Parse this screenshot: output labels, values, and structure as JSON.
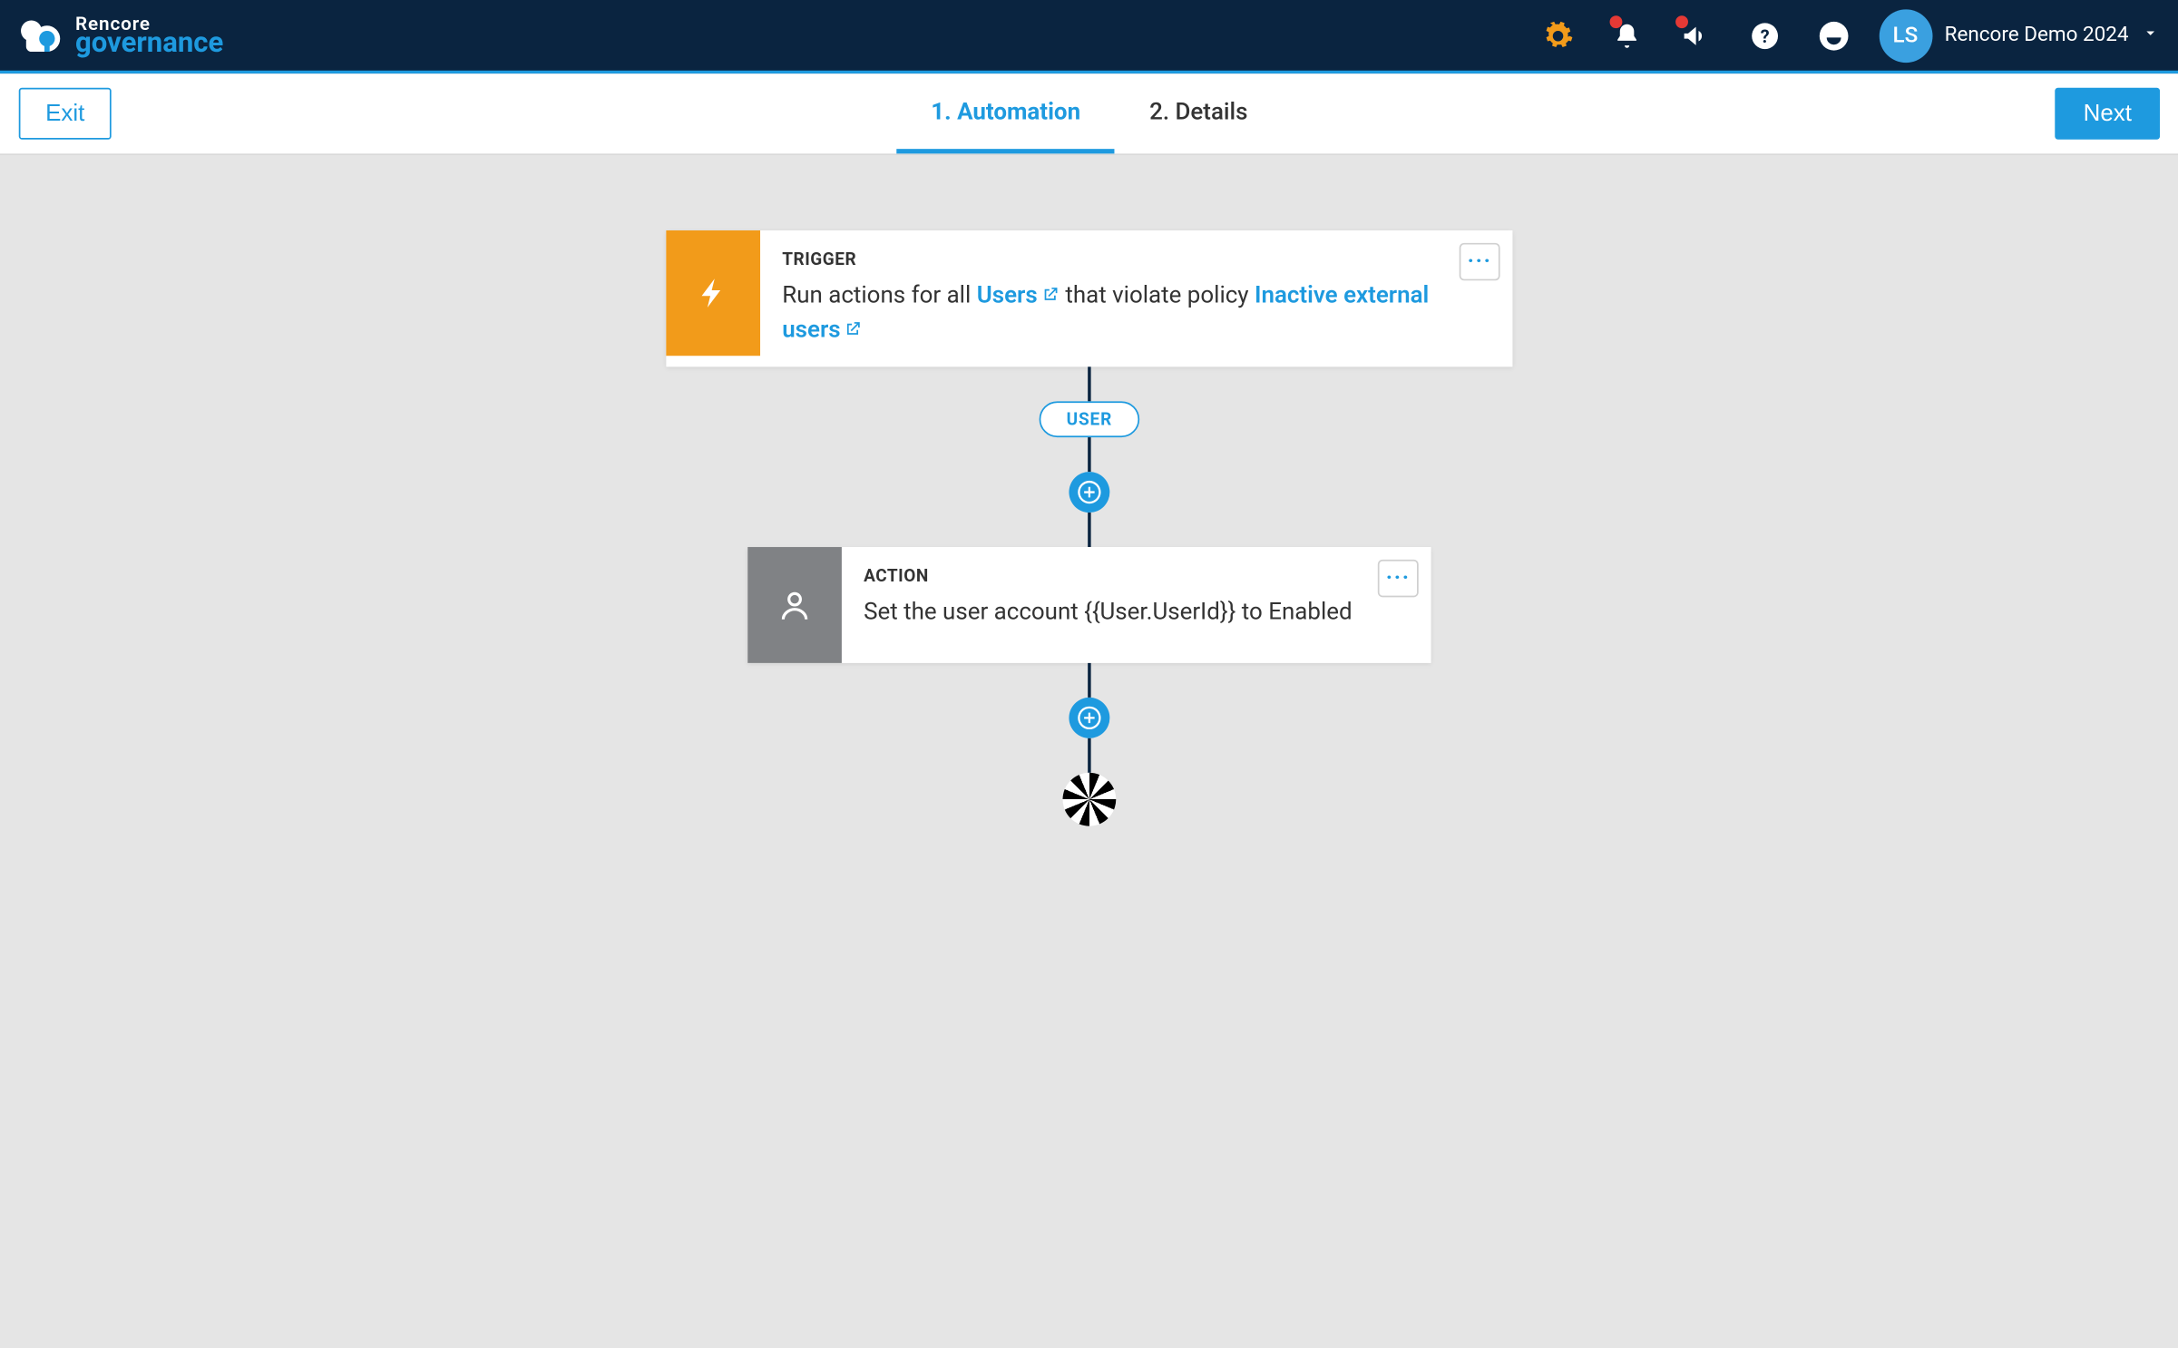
{
  "brand": {
    "line1": "Rencore",
    "line2": "governance"
  },
  "avatar_initials": "LS",
  "tenant_name": "Rencore Demo 2024",
  "buttons": {
    "exit": "Exit",
    "next": "Next"
  },
  "steps": [
    {
      "label": "1. Automation",
      "active": true
    },
    {
      "label": "2. Details",
      "active": false
    }
  ],
  "trigger": {
    "label": "TRIGGER",
    "pre": "Run actions for all",
    "link1": "Users",
    "mid": "that violate policy",
    "link2": "Inactive external users"
  },
  "pill_label": "USER",
  "action": {
    "label": "ACTION",
    "desc": "Set the user account {{User.UserId}} to Enabled"
  }
}
